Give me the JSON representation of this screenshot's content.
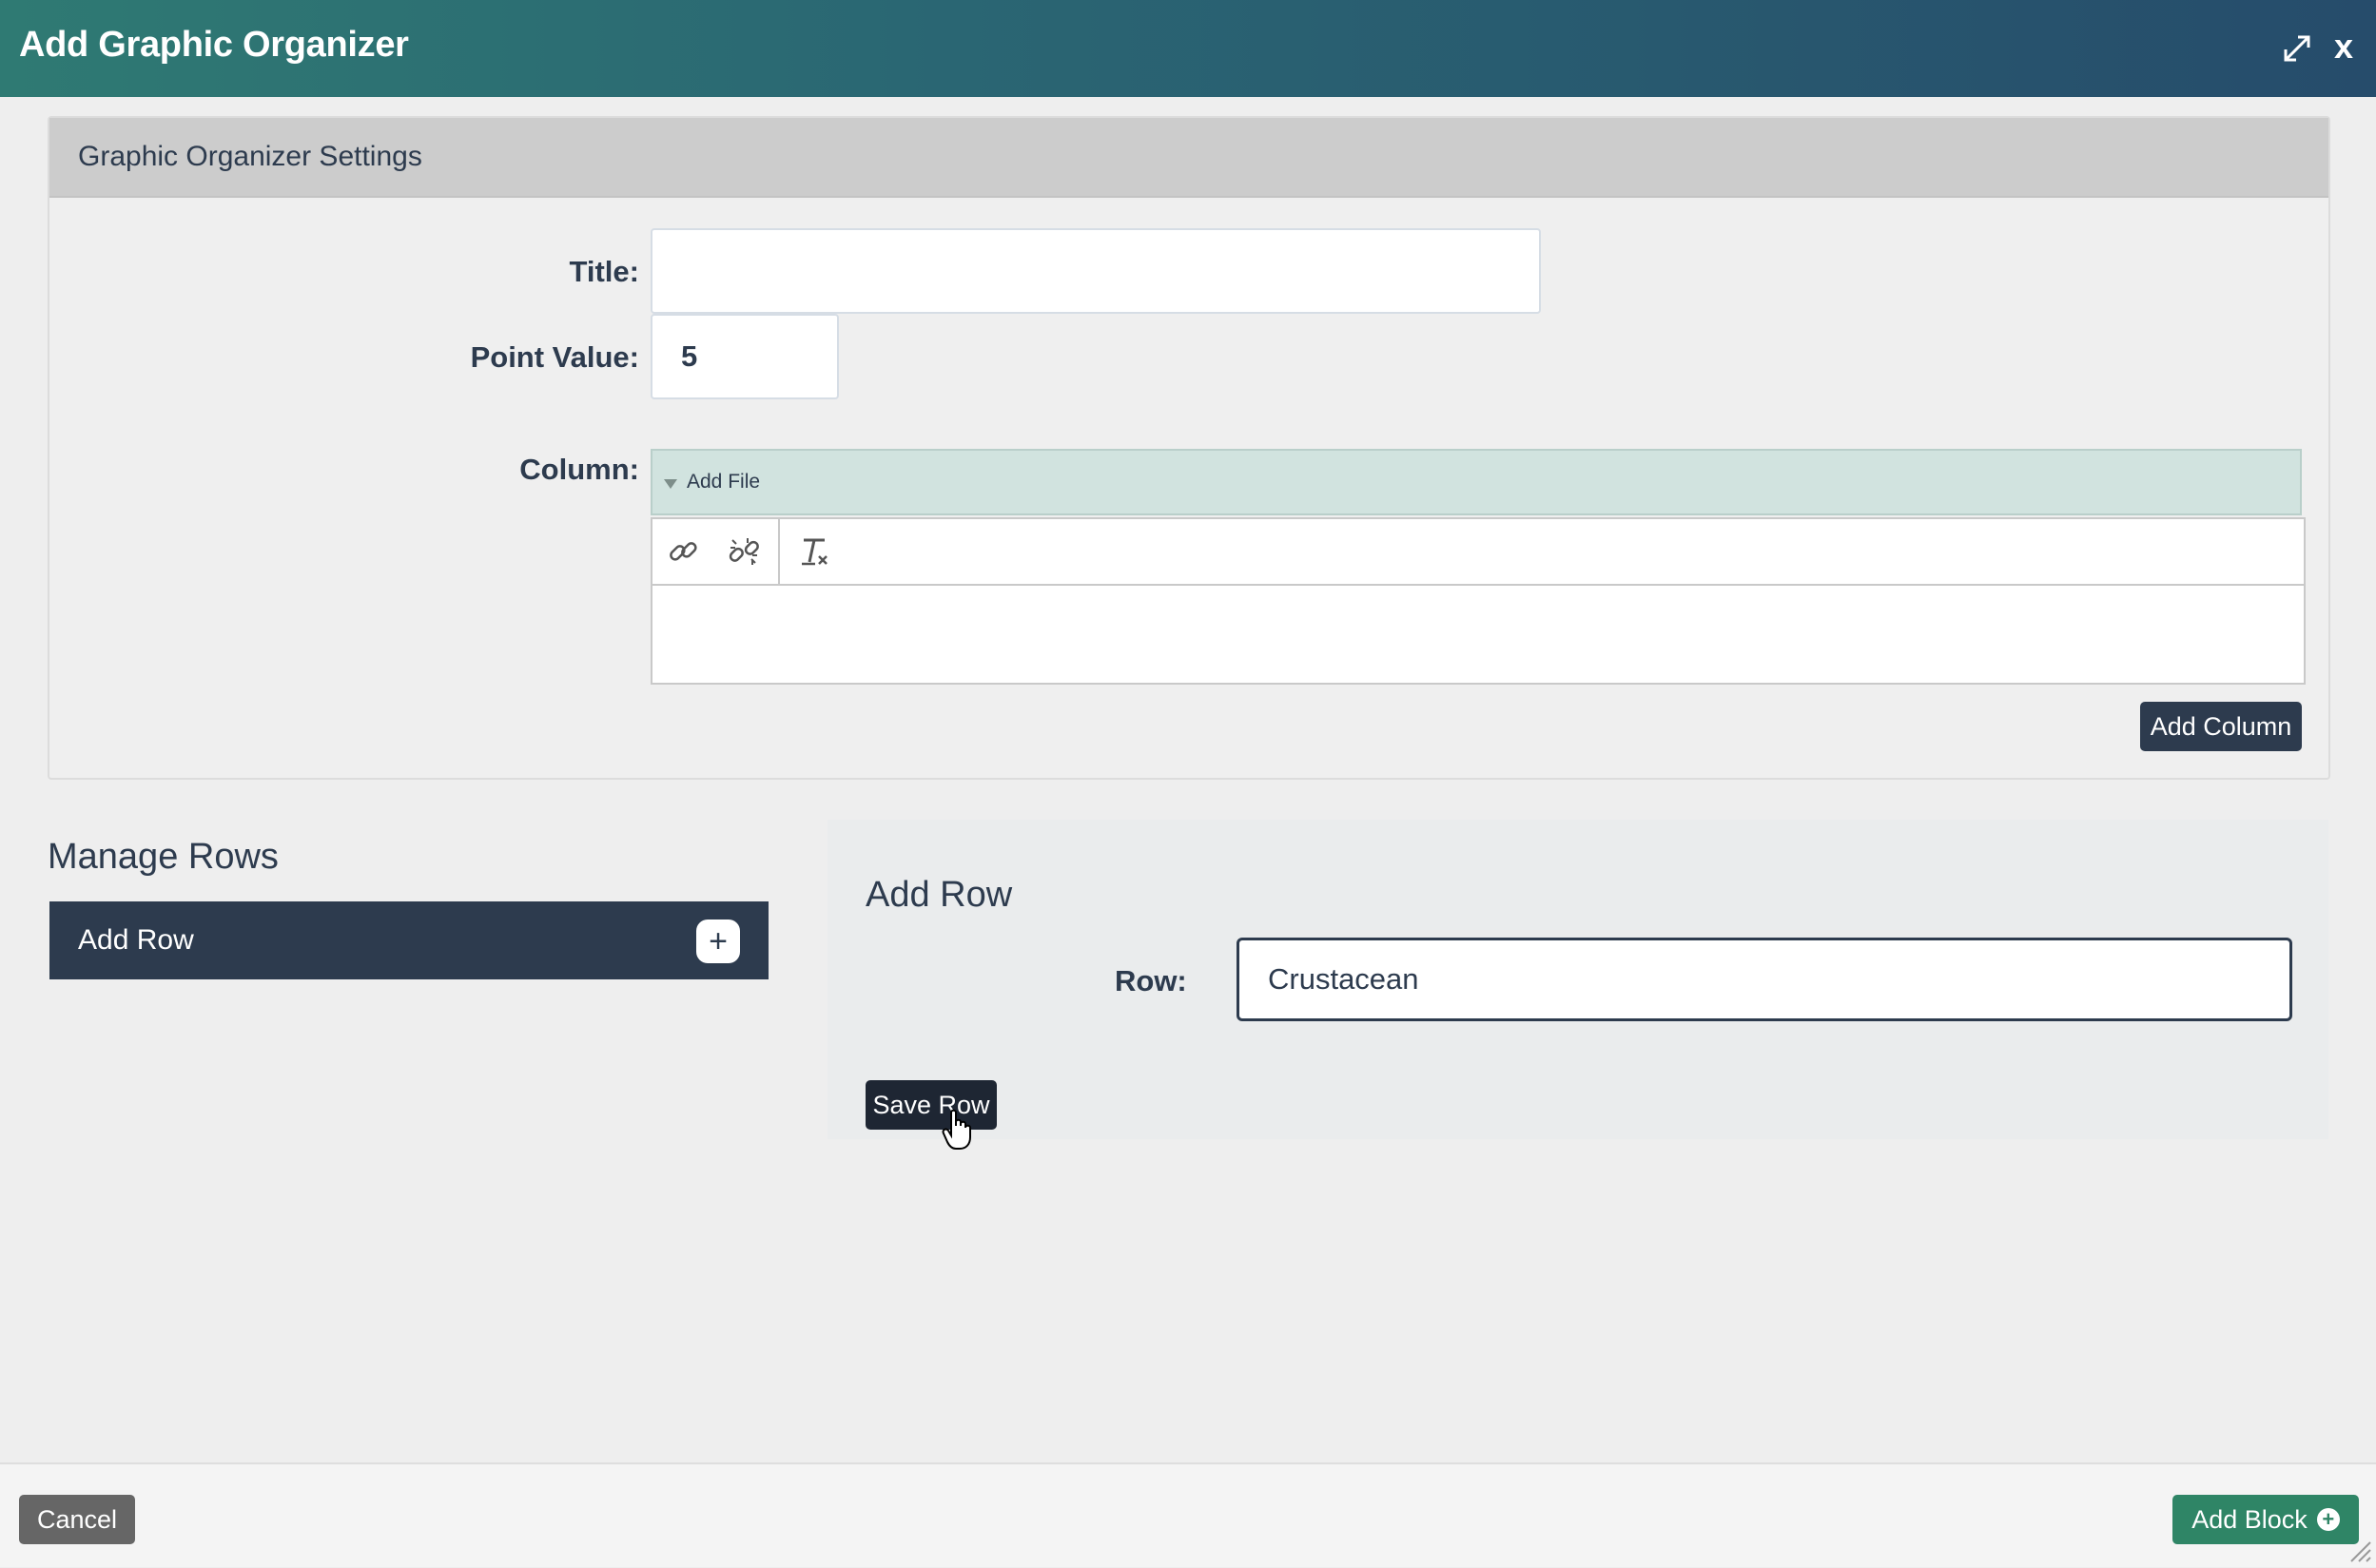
{
  "header": {
    "title": "Add Graphic Organizer",
    "close_label": "x",
    "expand_icon": "expand-arrows-icon"
  },
  "settings": {
    "heading": "Graphic Organizer Settings",
    "title_label": "Title:",
    "title_value": "",
    "point_label": "Point Value:",
    "point_value": "5",
    "column_label": "Column:",
    "add_file_label": "Add File",
    "toolbar_icons": [
      "link-icon",
      "unlink-icon",
      "clear-format-icon"
    ],
    "add_column_label": "Add Column"
  },
  "manage_rows": {
    "heading": "Manage Rows",
    "add_row_label": "Add Row"
  },
  "add_row_panel": {
    "heading": "Add Row",
    "row_label": "Row:",
    "row_value": "Crustacean",
    "save_label": "Save Row"
  },
  "footer": {
    "cancel_label": "Cancel",
    "add_block_label": "Add Block"
  },
  "colors": {
    "header_gradient_start": "#2f7a73",
    "header_gradient_end": "#264c6b",
    "dark_navy": "#2d3b4e",
    "green": "#2f8566"
  }
}
